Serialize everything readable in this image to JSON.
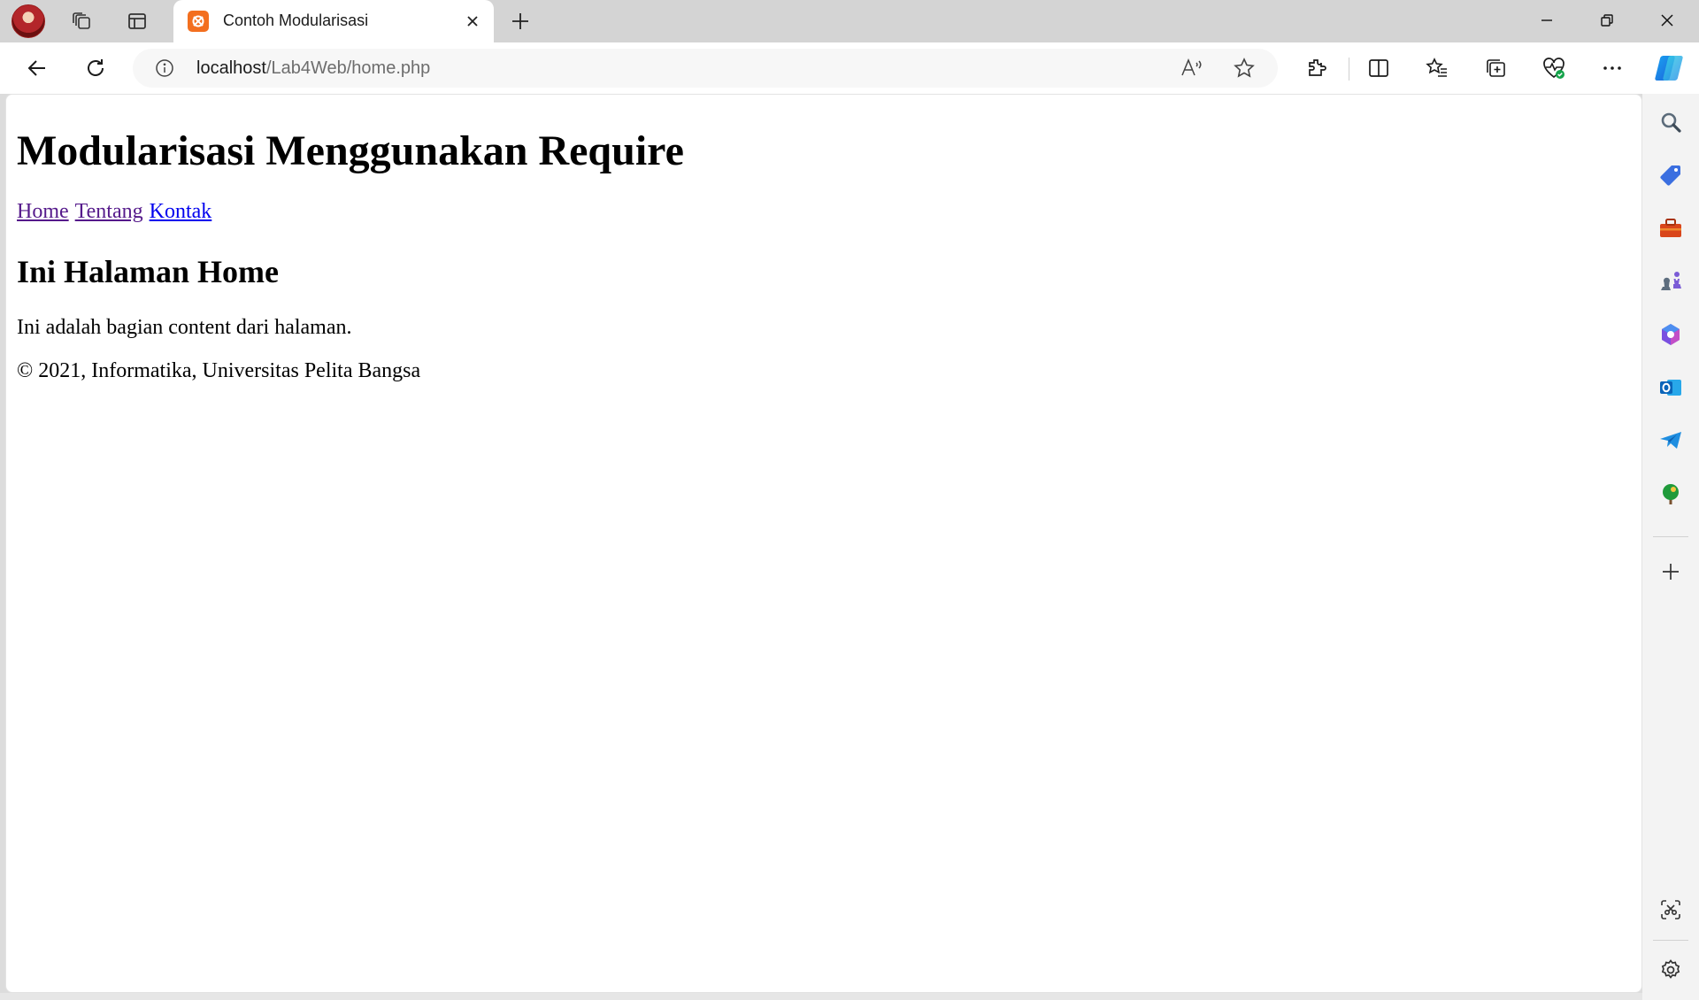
{
  "browser": {
    "tab": {
      "title": "Contoh Modularisasi"
    },
    "address": {
      "host": "localhost",
      "path": "/Lab4Web/home.php"
    }
  },
  "page": {
    "heading": "Modularisasi Menggunakan Require",
    "nav": [
      {
        "label": "Home"
      },
      {
        "label": "Tentang"
      },
      {
        "label": "Kontak"
      }
    ],
    "subheading": "Ini Halaman Home",
    "content": "Ini adalah bagian content dari halaman.",
    "footer": "© 2021, Informatika, Universitas Pelita Bangsa"
  },
  "icons": {
    "toolbar": [
      "back-icon",
      "refresh-icon",
      "info-icon",
      "read-aloud-icon",
      "favorite-star-icon",
      "extensions-icon",
      "split-screen-icon",
      "favorites-icon",
      "collections-icon",
      "browser-essentials-icon",
      "more-icon",
      "copilot-icon"
    ],
    "sidebar": [
      "search-icon",
      "shopping-icon",
      "tools-icon",
      "games-icon",
      "microsoft-365-icon",
      "outlook-icon",
      "telegram-icon",
      "tree-icon",
      "add-icon",
      "screenshot-icon",
      "settings-icon"
    ]
  },
  "colors": {
    "link_visited": "#551a8b",
    "link_unvisited": "#0000ee",
    "tab_favicon": "#f36f1f"
  }
}
